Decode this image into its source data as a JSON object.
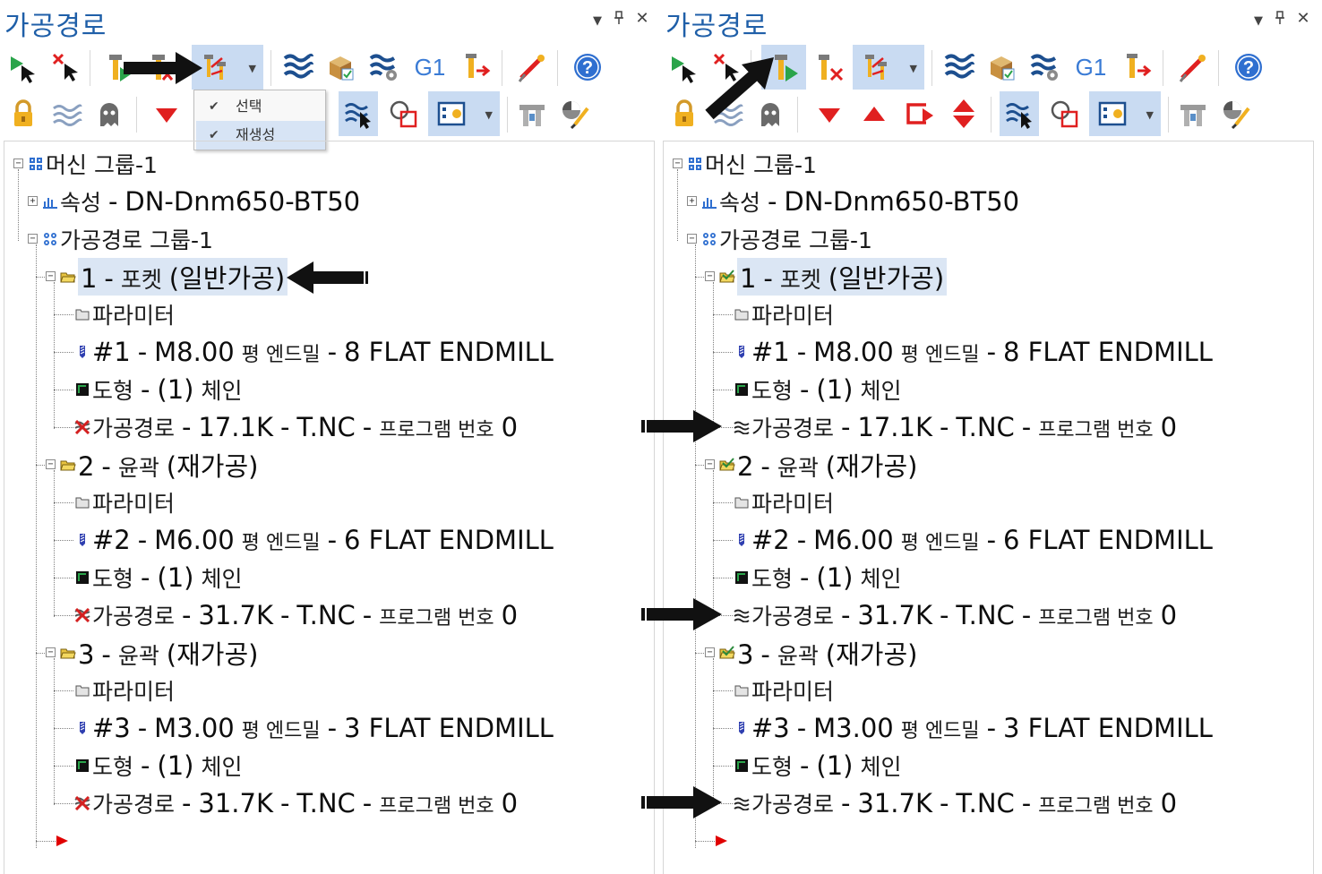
{
  "left": {
    "title": "가공경로",
    "menu": {
      "items": [
        "선택",
        "재생성"
      ]
    },
    "tree": {
      "root": {
        "label": "머신 그룹-1"
      },
      "props": {
        "prefix": "속성",
        "sep": "-",
        "name": "DN-Dnm650-BT50"
      },
      "group": {
        "label": "가공경로 그룹-1"
      },
      "ops": [
        {
          "num": "1",
          "sep": "-",
          "name": "포켓",
          "paren": "(일반가공)",
          "params": "파라미터",
          "tool": {
            "id": "#1",
            "sep1": "-",
            "size": "M8.00",
            "kind": "평 엔드밀",
            "sep2": "-",
            "desc": "8 FLAT ENDMILL"
          },
          "geom": {
            "name": "도형",
            "sep": "-",
            "val": "(1)",
            "unit": "체인"
          },
          "path": {
            "name": "가공경로",
            "sep1": "-",
            "size": "17.1K",
            "sep2": "-",
            "file": "T.NC",
            "sep3": "-",
            "prog": "프로그램 번호",
            "num": "0"
          }
        },
        {
          "num": "2",
          "sep": "-",
          "name": "윤곽",
          "paren": "(재가공)",
          "params": "파라미터",
          "tool": {
            "id": "#2",
            "sep1": "-",
            "size": "M6.00",
            "kind": "평 엔드밀",
            "sep2": "-",
            "desc": "6 FLAT ENDMILL"
          },
          "geom": {
            "name": "도형",
            "sep": "-",
            "val": "(1)",
            "unit": "체인"
          },
          "path": {
            "name": "가공경로",
            "sep1": "-",
            "size": "31.7K",
            "sep2": "-",
            "file": "T.NC",
            "sep3": "-",
            "prog": "프로그램 번호",
            "num": "0"
          }
        },
        {
          "num": "3",
          "sep": "-",
          "name": "윤곽",
          "paren": "(재가공)",
          "params": "파라미터",
          "tool": {
            "id": "#3",
            "sep1": "-",
            "size": "M3.00",
            "kind": "평 엔드밀",
            "sep2": "-",
            "desc": "3 FLAT ENDMILL"
          },
          "geom": {
            "name": "도형",
            "sep": "-",
            "val": "(1)",
            "unit": "체인"
          },
          "path": {
            "name": "가공경로",
            "sep1": "-",
            "size": "31.7K",
            "sep2": "-",
            "file": "T.NC",
            "sep3": "-",
            "prog": "프로그램 번호",
            "num": "0"
          }
        }
      ]
    }
  },
  "right": {
    "title": "가공경로",
    "tree": {
      "root": {
        "label": "머신 그룹-1"
      },
      "props": {
        "prefix": "속성",
        "sep": "-",
        "name": "DN-Dnm650-BT50"
      },
      "group": {
        "label": "가공경로 그룹-1"
      },
      "ops": [
        {
          "num": "1",
          "sep": "-",
          "name": "포켓",
          "paren": "(일반가공)",
          "params": "파라미터",
          "tool": {
            "id": "#1",
            "sep1": "-",
            "size": "M8.00",
            "kind": "평 엔드밀",
            "sep2": "-",
            "desc": "8 FLAT ENDMILL"
          },
          "geom": {
            "name": "도형",
            "sep": "-",
            "val": "(1)",
            "unit": "체인"
          },
          "path": {
            "name": "가공경로",
            "sep1": "-",
            "size": "17.1K",
            "sep2": "-",
            "file": "T.NC",
            "sep3": "-",
            "prog": "프로그램 번호",
            "num": "0"
          }
        },
        {
          "num": "2",
          "sep": "-",
          "name": "윤곽",
          "paren": "(재가공)",
          "params": "파라미터",
          "tool": {
            "id": "#2",
            "sep1": "-",
            "size": "M6.00",
            "kind": "평 엔드밀",
            "sep2": "-",
            "desc": "6 FLAT ENDMILL"
          },
          "geom": {
            "name": "도형",
            "sep": "-",
            "val": "(1)",
            "unit": "체인"
          },
          "path": {
            "name": "가공경로",
            "sep1": "-",
            "size": "31.7K",
            "sep2": "-",
            "file": "T.NC",
            "sep3": "-",
            "prog": "프로그램 번호",
            "num": "0"
          }
        },
        {
          "num": "3",
          "sep": "-",
          "name": "윤곽",
          "paren": "(재가공)",
          "params": "파라미터",
          "tool": {
            "id": "#3",
            "sep1": "-",
            "size": "M3.00",
            "kind": "평 엔드밀",
            "sep2": "-",
            "desc": "3 FLAT ENDMILL"
          },
          "geom": {
            "name": "도형",
            "sep": "-",
            "val": "(1)",
            "unit": "체인"
          },
          "path": {
            "name": "가공경로",
            "sep1": "-",
            "size": "31.7K",
            "sep2": "-",
            "file": "T.NC",
            "sep3": "-",
            "prog": "프로그램 번호",
            "num": "0"
          }
        }
      ]
    }
  },
  "toolbar": {
    "g1_label": "G1"
  },
  "colors": {
    "title": "#1f5fa8",
    "selection": "#dbe6f4",
    "active_button": "#c9dbf2",
    "invalid_mark": "#d42020",
    "end_marker": "#e00000"
  },
  "icons": [
    "select-arrow-icon",
    "deselect-icon",
    "regenerate-all-icon",
    "regenerate-dirty-icon",
    "toggle-select-icon",
    "backplot-icon",
    "verify-icon",
    "simulate-icon",
    "post-process-icon",
    "g1-icon",
    "high-speed-icon",
    "edit-icon",
    "help-icon",
    "lock-icon",
    "wave-icon",
    "ghost-icon",
    "move-down-icon",
    "move-up-icon",
    "insert-icon",
    "move-updown-icon",
    "display-toolpath-icon",
    "select-geometry-icon",
    "options-icon",
    "machine-icon",
    "settings-icon"
  ]
}
